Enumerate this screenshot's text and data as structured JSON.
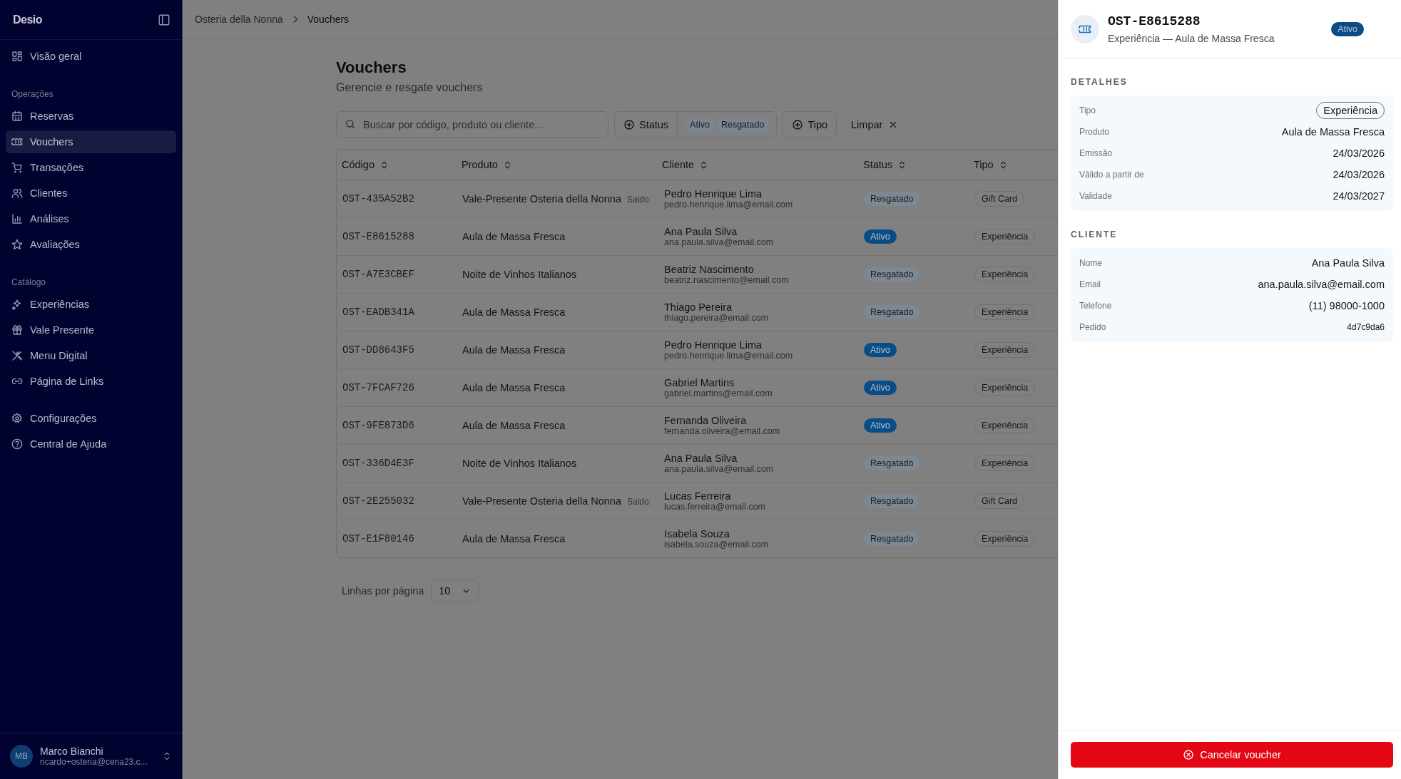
{
  "sidebar": {
    "logo": "Desio",
    "groups": [
      {
        "items": [
          {
            "label": "Visão geral",
            "selected": false
          }
        ]
      },
      {
        "label": "Operações",
        "items": [
          {
            "label": "Reservas",
            "selected": false
          },
          {
            "label": "Vouchers",
            "selected": true
          },
          {
            "label": "Transações",
            "selected": false
          },
          {
            "label": "Clientes",
            "selected": false
          },
          {
            "label": "Análises",
            "selected": false
          },
          {
            "label": "Avaliações",
            "selected": false
          }
        ]
      },
      {
        "label": "Catálogo",
        "items": [
          {
            "label": "Experiências",
            "selected": false
          },
          {
            "label": "Vale Presente",
            "selected": false
          },
          {
            "label": "Menu Digital",
            "selected": false
          },
          {
            "label": "Página de Links",
            "selected": false
          }
        ]
      },
      {
        "items": [
          {
            "label": "Configurações",
            "selected": false
          },
          {
            "label": "Central de Ajuda",
            "selected": false
          }
        ]
      }
    ],
    "user": {
      "initials": "MB",
      "name": "Marco Bianchi",
      "email": "ricardo+osteria@cena23.c..."
    }
  },
  "breadcrumb": [
    "Osteria della Nonna",
    "Vouchers"
  ],
  "page": {
    "title": "Vouchers",
    "subtitle": "Gerencie e resgate vouchers"
  },
  "filters": {
    "search_placeholder": "Buscar por código, produto ou cliente...",
    "status_label": "Status",
    "status_chips": [
      "Ativo",
      "Resgatado"
    ],
    "tipo_label": "Tipo",
    "clear_label": "Limpar"
  },
  "table": {
    "columns": [
      "Código",
      "Produto",
      "Cliente",
      "Status",
      "Tipo"
    ],
    "rows": [
      {
        "code": "OST-435A52B2",
        "product": "Vale-Presente Osteria della Nonna",
        "saldo": "Saldo:",
        "client": "Pedro Henrique Lima",
        "email": "pedro.henrique.lima@email.com",
        "status": "Resgatado",
        "active": false,
        "type": "Gift Card"
      },
      {
        "code": "OST-E8615288",
        "product": "Aula de Massa Fresca",
        "client": "Ana Paula Silva",
        "email": "ana.paula.silva@email.com",
        "status": "Ativo",
        "active": true,
        "type": "Experiência"
      },
      {
        "code": "OST-A7E3CBEF",
        "product": "Noite de Vinhos Italianos",
        "client": "Beatriz Nascimento",
        "email": "beatriz.nascimento@email.com",
        "status": "Resgatado",
        "active": false,
        "type": "Experiência"
      },
      {
        "code": "OST-EADB341A",
        "product": "Aula de Massa Fresca",
        "client": "Thiago Pereira",
        "email": "thiago.pereira@email.com",
        "status": "Resgatado",
        "active": false,
        "type": "Experiência"
      },
      {
        "code": "OST-DD8643F5",
        "product": "Aula de Massa Fresca",
        "client": "Pedro Henrique Lima",
        "email": "pedro.henrique.lima@email.com",
        "status": "Ativo",
        "active": true,
        "type": "Experiência"
      },
      {
        "code": "OST-7FCAF726",
        "product": "Aula de Massa Fresca",
        "client": "Gabriel Martins",
        "email": "gabriel.martins@email.com",
        "status": "Ativo",
        "active": true,
        "type": "Experiência"
      },
      {
        "code": "OST-9FE873D6",
        "product": "Aula de Massa Fresca",
        "client": "Fernanda Oliveira",
        "email": "fernanda.oliveira@email.com",
        "status": "Ativo",
        "active": true,
        "type": "Experiência"
      },
      {
        "code": "OST-336D4E3F",
        "product": "Noite de Vinhos Italianos",
        "client": "Ana Paula Silva",
        "email": "ana.paula.silva@email.com",
        "status": "Resgatado",
        "active": false,
        "type": "Experiência"
      },
      {
        "code": "OST-2E255032",
        "product": "Vale-Presente Osteria della Nonna",
        "saldo": "Saldo:",
        "client": "Lucas Ferreira",
        "email": "lucas.ferreira@email.com",
        "status": "Resgatado",
        "active": false,
        "type": "Gift Card"
      },
      {
        "code": "OST-E1F80146",
        "product": "Aula de Massa Fresca",
        "client": "Isabela Souza",
        "email": "isabela.souza@email.com",
        "status": "Resgatado",
        "active": false,
        "type": "Experiência"
      }
    ]
  },
  "pagination": {
    "label": "Linhas por página",
    "value": "10"
  },
  "panel": {
    "code": "OST-E8615288",
    "subtitle": "Experiência — Aula de Massa Fresca",
    "status": "Ativo",
    "active": true,
    "sections": [
      {
        "title": "DETALHES",
        "rows": [
          {
            "label": "Tipo",
            "value": "Experiência",
            "kind": "pill"
          },
          {
            "label": "Produto",
            "value": "Aula de Massa Fresca",
            "kind": "text"
          },
          {
            "label": "Emissão",
            "value": "24/03/2026",
            "kind": "text"
          },
          {
            "label": "Válido a partir de",
            "value": "24/03/2026",
            "kind": "text"
          },
          {
            "label": "Validade",
            "value": "24/03/2027",
            "kind": "text"
          }
        ]
      },
      {
        "title": "CLIENTE",
        "rows": [
          {
            "label": "Nome",
            "value": "Ana Paula Silva",
            "kind": "text"
          },
          {
            "label": "Email",
            "value": "ana.paula.silva@email.com",
            "kind": "text"
          },
          {
            "label": "Telefone",
            "value": "(11) 98000-1000",
            "kind": "text"
          },
          {
            "label": "Pedido",
            "value": "4d7c9da6",
            "kind": "small"
          }
        ]
      }
    ],
    "cancel_button": "Cancelar voucher"
  }
}
